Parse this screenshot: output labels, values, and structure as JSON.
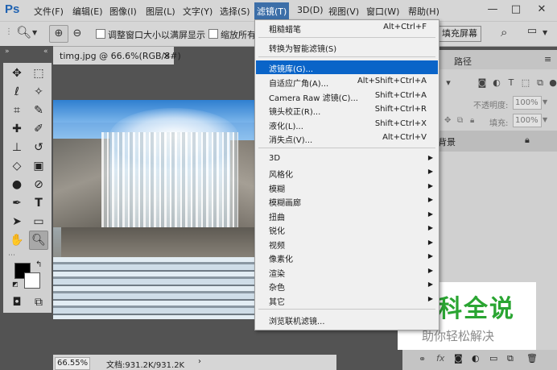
{
  "app": {
    "logo": "Ps"
  },
  "menubar": {
    "items": [
      "文件(F)",
      "编辑(E)",
      "图像(I)",
      "图层(L)",
      "文字(Y)",
      "选择(S)",
      "滤镜(T)",
      "3D(D)",
      "视图(V)",
      "窗口(W)",
      "帮助(H)"
    ],
    "active": "滤镜(T)"
  },
  "window_controls": {
    "minimize": "—",
    "maximize": "□",
    "close": "✕"
  },
  "options_bar": {
    "checkbox1_label": "调整窗口大小以满屏显示",
    "checkbox2_label": "缩放所有窗",
    "fill_screen_label": "填充屏幕"
  },
  "document": {
    "tab_title": "timg.jpg @ 66.6%(RGB/8#)",
    "tab_close": "×",
    "zoom_status": "66.55%",
    "doc_info": "文档:931.2K/931.2K"
  },
  "layers_panel": {
    "tab_paths": "路径",
    "opacity_label": "不透明度:",
    "opacity_value": "100%",
    "fill_label": "填充:",
    "fill_value": "100%",
    "background_layer": "背景"
  },
  "filter_menu": {
    "items": [
      {
        "label": "粗糙蜡笔",
        "shortcut": "Alt+Ctrl+F"
      },
      {
        "label": "转换为智能滤镜(S)",
        "shortcut": ""
      },
      {
        "label": "滤镜库(G)...",
        "shortcut": "",
        "highlighted": true
      },
      {
        "label": "自适应广角(A)...",
        "shortcut": "Alt+Shift+Ctrl+A"
      },
      {
        "label": "Camera Raw 滤镜(C)...",
        "shortcut": "Shift+Ctrl+A"
      },
      {
        "label": "镜头校正(R)...",
        "shortcut": "Shift+Ctrl+R"
      },
      {
        "label": "液化(L)...",
        "shortcut": "Shift+Ctrl+X"
      },
      {
        "label": "消失点(V)...",
        "shortcut": "Alt+Ctrl+V"
      },
      {
        "label": "3D",
        "submenu": true
      },
      {
        "label": "风格化",
        "submenu": true
      },
      {
        "label": "模糊",
        "submenu": true
      },
      {
        "label": "模糊画廊",
        "submenu": true
      },
      {
        "label": "扭曲",
        "submenu": true
      },
      {
        "label": "锐化",
        "submenu": true
      },
      {
        "label": "视频",
        "submenu": true
      },
      {
        "label": "像素化",
        "submenu": true
      },
      {
        "label": "渲染",
        "submenu": true
      },
      {
        "label": "杂色",
        "submenu": true
      },
      {
        "label": "其它",
        "submenu": true
      },
      {
        "label": "浏览联机滤镜...",
        "shortcut": ""
      }
    ]
  },
  "watermark": {
    "title": "百科全说",
    "subtitle": "助你轻松解决"
  },
  "colors": {
    "accent": "#0a64c8",
    "menu_active": "#3c6ea8",
    "ps_blue": "#1f62b1",
    "watermark_green": "#2aa532"
  }
}
